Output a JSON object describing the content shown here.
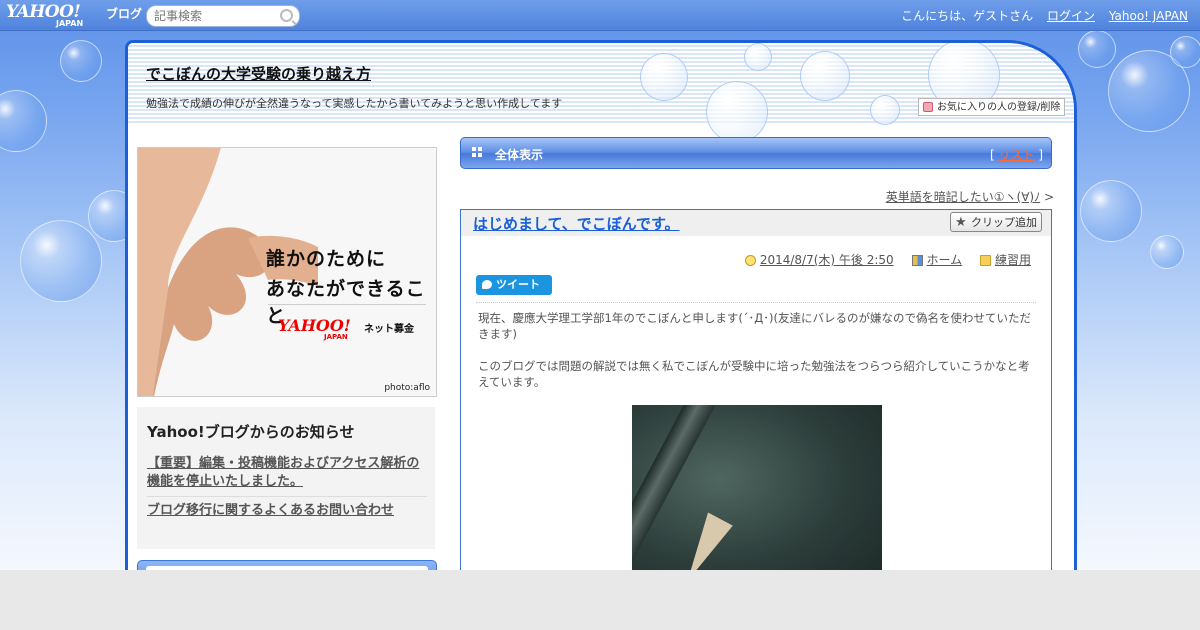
{
  "topbar": {
    "logo_main": "YAHOO!",
    "logo_sub": "JAPAN",
    "logo_blog": "ブログ",
    "search_placeholder": "記事検索",
    "greeting": "こんにちは、ゲストさん",
    "login": "ログイン",
    "yahoo_japan": "Yahoo! JAPAN"
  },
  "blog": {
    "title": "でこぼんの大学受験の乗り越え方",
    "description": "勉強法で成績の伸びが全然違うなって実感したから書いてみようと思い作成してます",
    "favorite_button": "お気に入りの人の登録/削除"
  },
  "ad": {
    "line1": "誰かのために",
    "line2": "あなたができること",
    "logo": "YAHOO!",
    "logo_sub": "JAPAN",
    "service": "ネット募金",
    "credit": "photo:aflo"
  },
  "notice": {
    "heading": "Yahoo!ブログからのお知らせ",
    "links": [
      "【重要】編集・投稿機能およびアクセス解析の機能を停止いたしました。",
      "ブログ移行に関するよくあるお問い合わせ"
    ]
  },
  "viewbar": {
    "label": "全体表示",
    "bracket_open": "[",
    "list_link": "リスト",
    "bracket_close": "]"
  },
  "navigation": {
    "next_article": "英単語を暗記したい①ヽ(∀)ﾉ",
    "arrow": ">"
  },
  "entry": {
    "title": "はじめまして、でこぼんです。",
    "clip_button": "クリップ追加",
    "date": "2014/8/7(木) 午後 2:50",
    "category_home": "ホーム",
    "category": "練習用",
    "tweet_button": "ツイート",
    "paragraph1": "現在、慶應大学理工学部1年のでこぼんと申します(´･Д･)(友達にバレるのが嫌なので偽名を使わせていただきます)",
    "paragraph2": "このブログでは問題の解説では無く私でこぼんが受験中に培った勉強法をつらつら紹介していこうかなと考えています。"
  },
  "colors": {
    "frame_blue": "#1c5fd6",
    "link_blue": "#1a5fd6",
    "list_link_orange": "#ff6a33",
    "tweet_blue": "#1b95e0"
  }
}
